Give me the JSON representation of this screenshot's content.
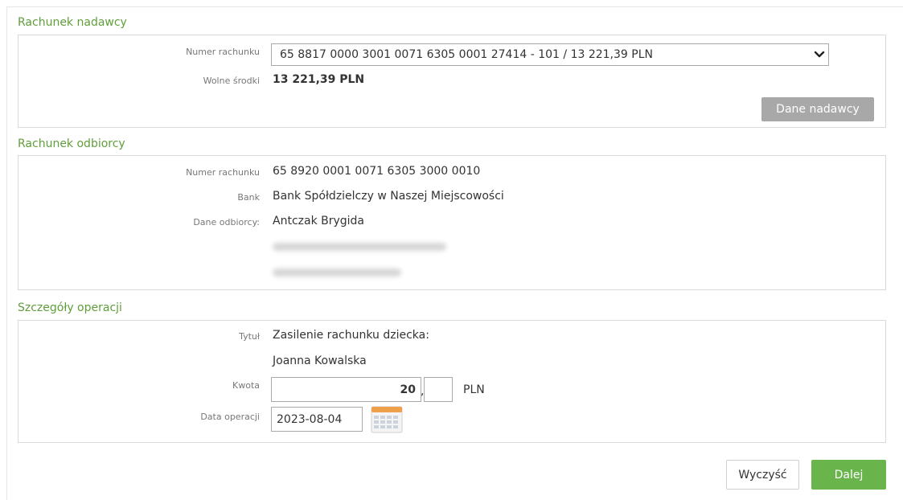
{
  "sender": {
    "section_title": "Rachunek nadawcy",
    "account_label": "Numer rachunku",
    "account_value": "65 8817 0000 3001 0071 6305 0001 27414 - 101 / 13 221,39 PLN",
    "funds_label": "Wolne środki",
    "funds_value": "13 221,39 PLN",
    "details_button": "Dane nadawcy"
  },
  "recipient": {
    "section_title": "Rachunek odbiorcy",
    "account_label": "Numer rachunku",
    "account_value": "65 8920 0001 0071 6305 3000 0010",
    "bank_label": "Bank",
    "bank_value": "Bank Spółdzielczy w Naszej Miejscowości",
    "data_label": "Dane odbiorcy:",
    "name_value": "Antczak Brygida"
  },
  "operation": {
    "section_title": "Szczegóły operacji",
    "title_label": "Tytuł",
    "title_line1": "Zasilenie rachunku dziecka:",
    "title_line2": "Joanna Kowalska",
    "amount_label": "Kwota",
    "amount_whole": "20",
    "amount_separator": ",",
    "amount_cents": "",
    "currency": "PLN",
    "date_label": "Data operacji",
    "date_value": "2023-08-04"
  },
  "actions": {
    "clear_label": "Wyczyść",
    "next_label": "Dalej"
  },
  "colors": {
    "section_title": "#5f9e3a",
    "next_button": "#69b54c",
    "details_button": "#a8a8a8"
  },
  "icons": [
    "chevron-down-icon",
    "calendar-icon"
  ]
}
